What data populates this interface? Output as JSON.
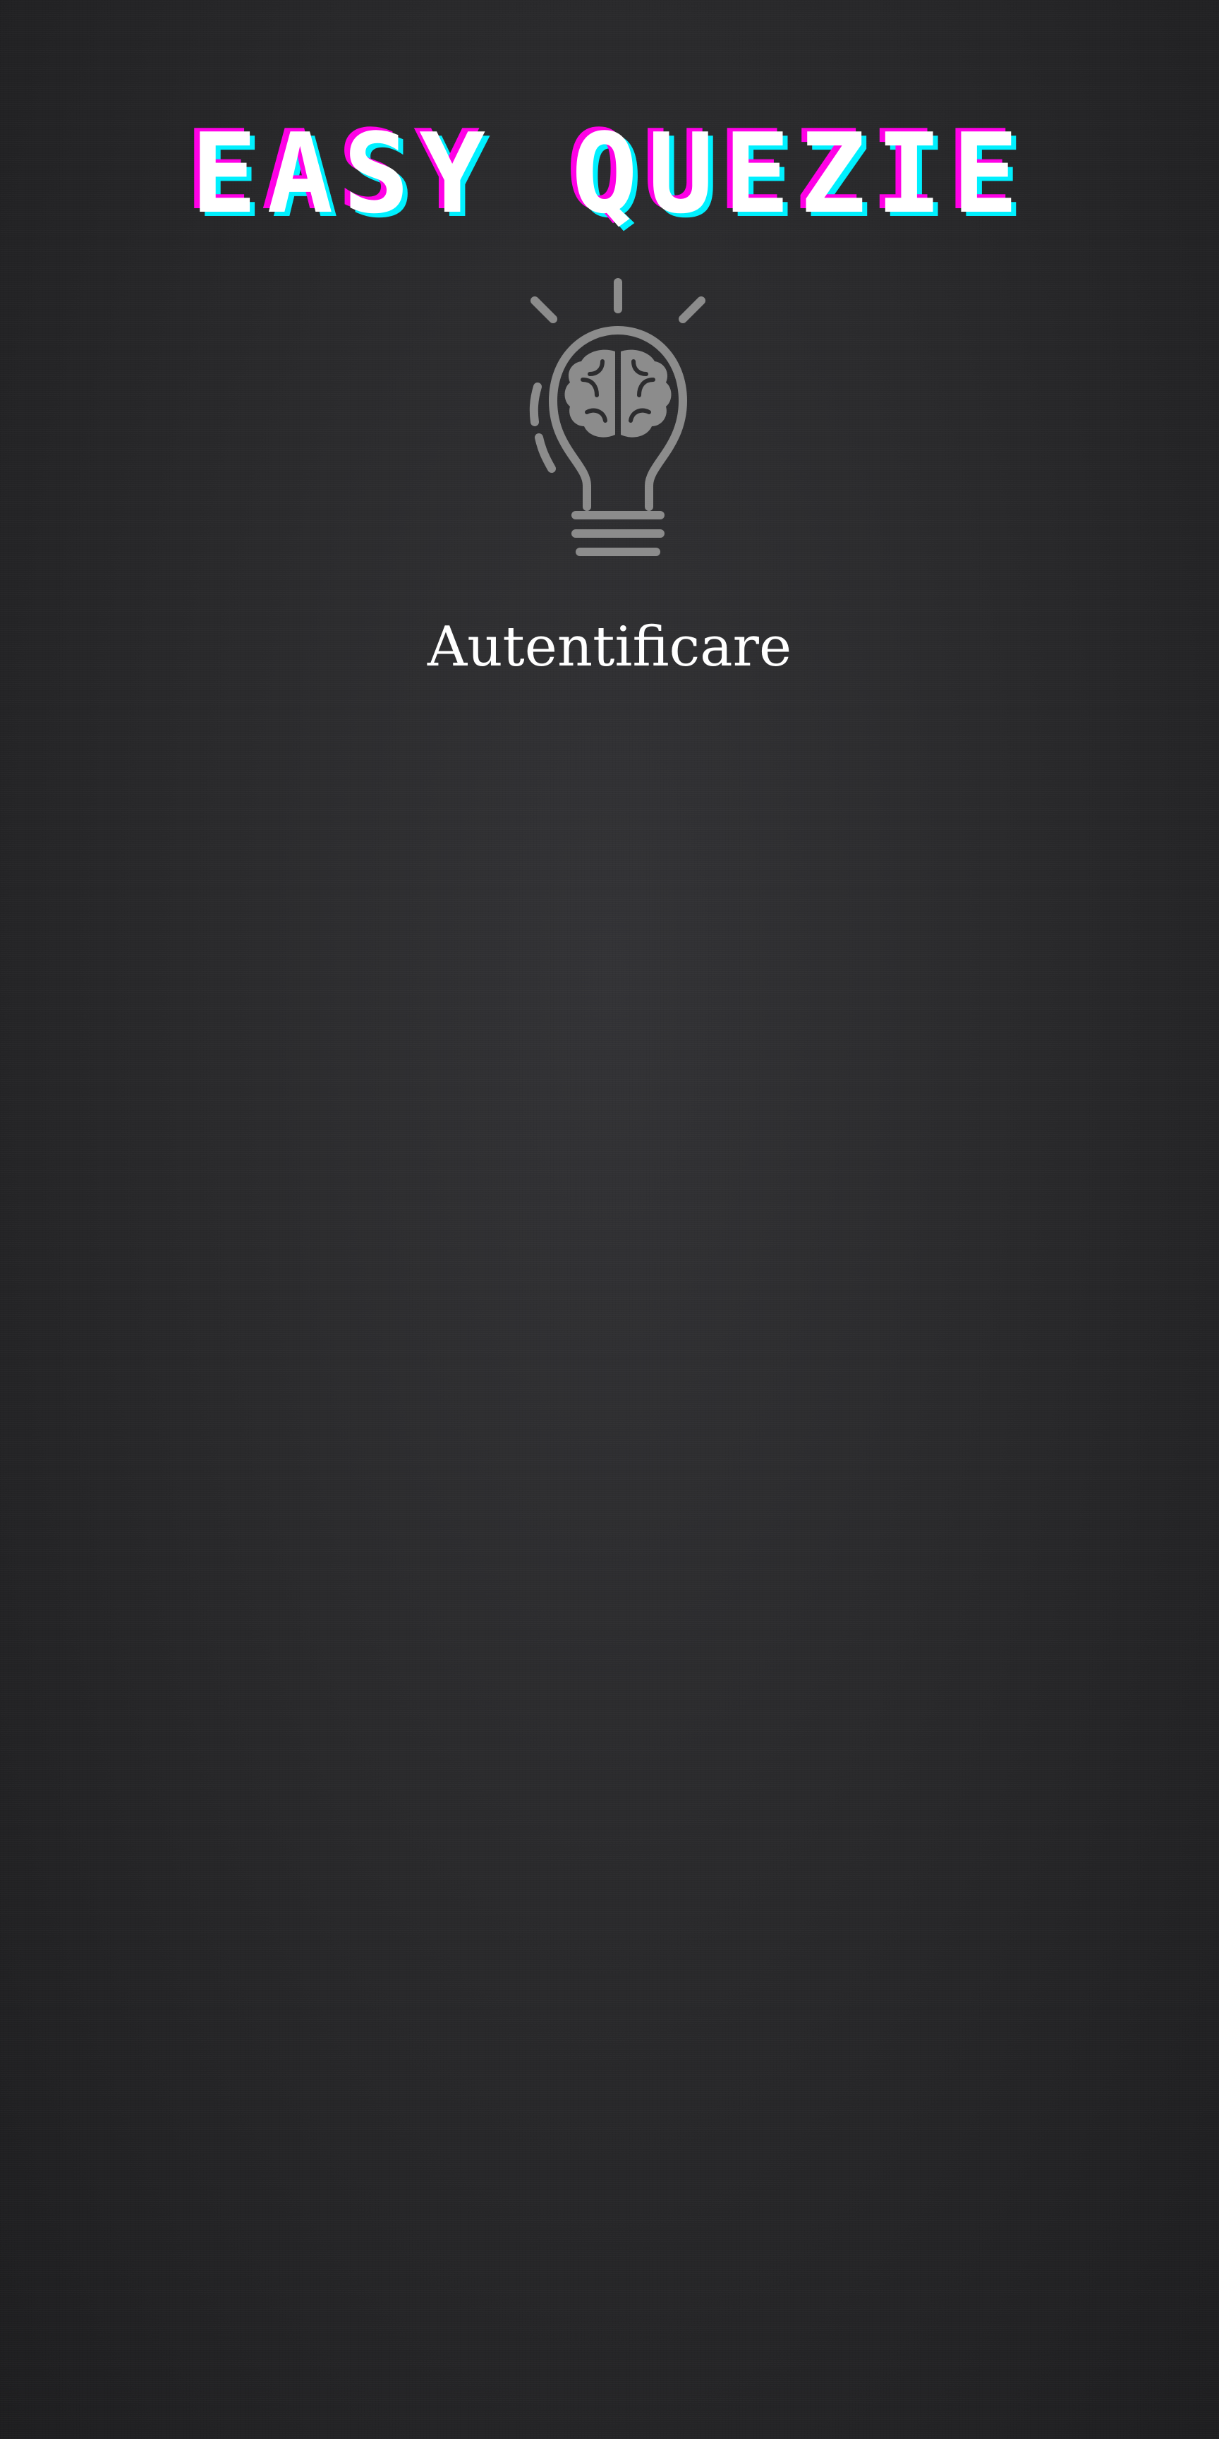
{
  "header": {
    "title": "EASY QUEZIE"
  },
  "logo": {
    "icon": "lightbulb-brain-icon"
  },
  "auth": {
    "label": "Autentificare"
  },
  "colors": {
    "background": "#2a2a2c",
    "title_text": "#ffffff",
    "title_shadow_magenta": "#ff00e6",
    "title_shadow_cyan": "#00f0ff",
    "icon": "#8c8c8c"
  }
}
